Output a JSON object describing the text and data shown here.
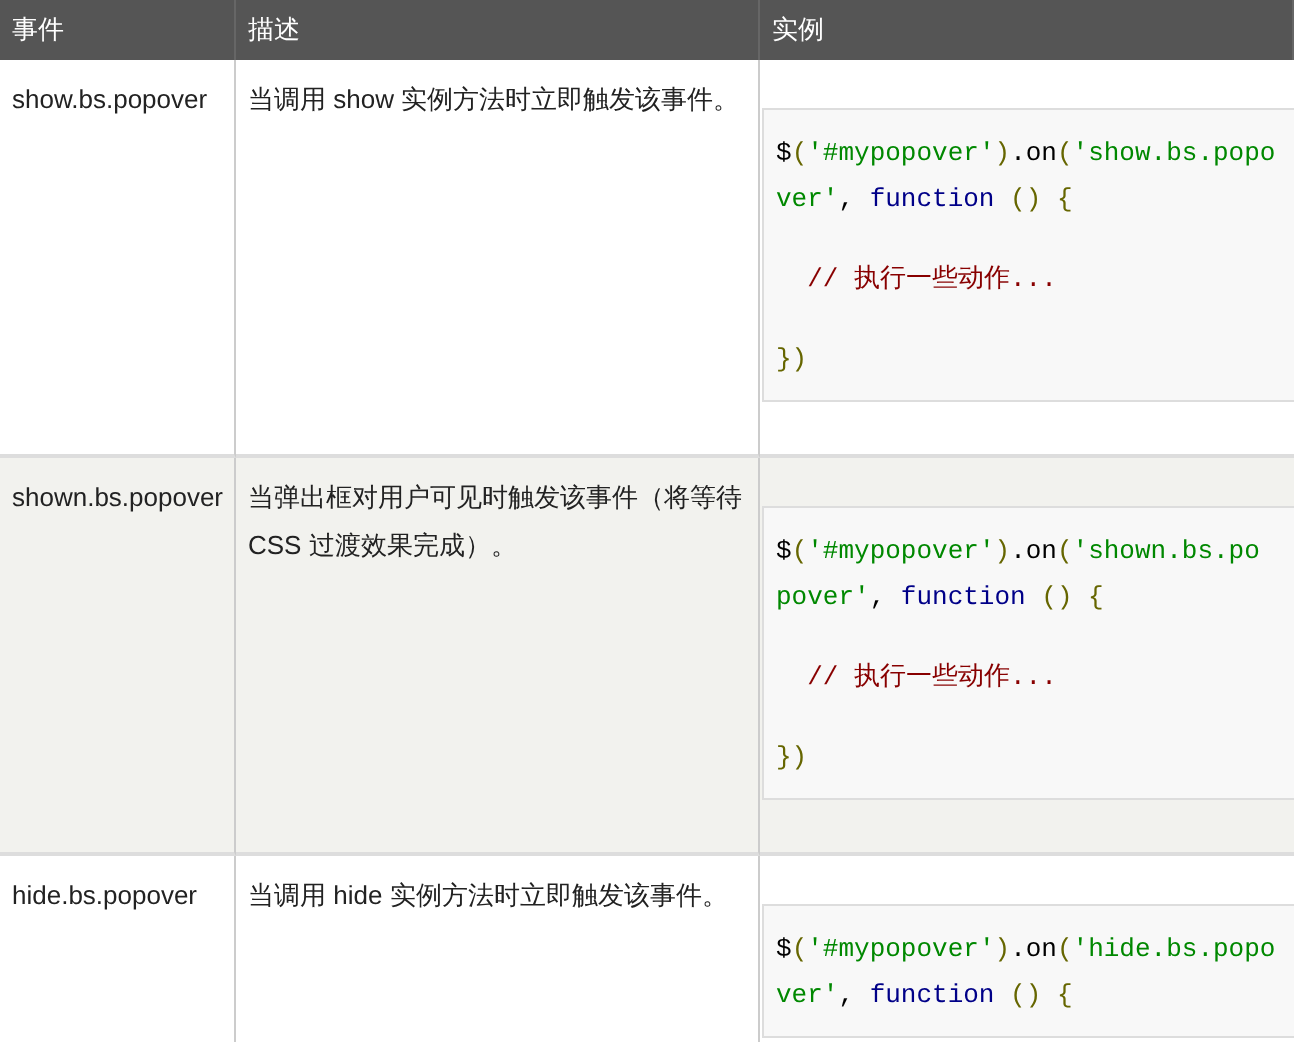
{
  "table": {
    "columns": [
      "事件",
      "描述",
      "实例"
    ],
    "rows": [
      {
        "event": "show.bs.popover",
        "description": "当调用 show 实例方法时立即触发该事件。",
        "code_blocks": [
          [
            {
              "tokens": [
                {
                  "text": "$",
                  "kind": "plain"
                },
                {
                  "text": "(",
                  "kind": "punct"
                },
                {
                  "text": "'#mypopover'",
                  "kind": "string"
                },
                {
                  "text": ")",
                  "kind": "punct"
                },
                {
                  "text": ".on",
                  "kind": "plain"
                },
                {
                  "text": "(",
                  "kind": "punct"
                },
                {
                  "text": "'show.bs.popo",
                  "kind": "string"
                }
              ]
            },
            {
              "tokens": [
                {
                  "text": "ver'",
                  "kind": "string"
                },
                {
                  "text": ", ",
                  "kind": "plain"
                },
                {
                  "text": "function",
                  "kind": "keyword"
                },
                {
                  "text": " () {",
                  "kind": "punct"
                }
              ]
            }
          ],
          [
            {
              "tokens": [
                {
                  "text": "  // 执行一些动作...",
                  "kind": "comment"
                }
              ]
            }
          ],
          [
            {
              "tokens": [
                {
                  "text": "})",
                  "kind": "punct"
                }
              ]
            }
          ]
        ]
      },
      {
        "event": "shown.bs.popover",
        "description": "当弹出框对用户可见时触发该事件（将等待 CSS 过渡效果完成）。",
        "code_blocks": [
          [
            {
              "tokens": [
                {
                  "text": "$",
                  "kind": "plain"
                },
                {
                  "text": "(",
                  "kind": "punct"
                },
                {
                  "text": "'#mypopover'",
                  "kind": "string"
                },
                {
                  "text": ")",
                  "kind": "punct"
                },
                {
                  "text": ".on",
                  "kind": "plain"
                },
                {
                  "text": "(",
                  "kind": "punct"
                },
                {
                  "text": "'shown.bs.po",
                  "kind": "string"
                }
              ]
            },
            {
              "tokens": [
                {
                  "text": "pover'",
                  "kind": "string"
                },
                {
                  "text": ", ",
                  "kind": "plain"
                },
                {
                  "text": "function",
                  "kind": "keyword"
                },
                {
                  "text": " () {",
                  "kind": "punct"
                }
              ]
            }
          ],
          [
            {
              "tokens": [
                {
                  "text": "  // 执行一些动作...",
                  "kind": "comment"
                }
              ]
            }
          ],
          [
            {
              "tokens": [
                {
                  "text": "})",
                  "kind": "punct"
                }
              ]
            }
          ]
        ]
      },
      {
        "event": "hide.bs.popover",
        "description": "当调用 hide 实例方法时立即触发该事件。",
        "code_blocks": [
          [
            {
              "tokens": [
                {
                  "text": "$",
                  "kind": "plain"
                },
                {
                  "text": "(",
                  "kind": "punct"
                },
                {
                  "text": "'#mypopover'",
                  "kind": "string"
                },
                {
                  "text": ")",
                  "kind": "punct"
                },
                {
                  "text": ".on",
                  "kind": "plain"
                },
                {
                  "text": "(",
                  "kind": "punct"
                },
                {
                  "text": "'hide.bs.popo",
                  "kind": "string"
                }
              ]
            },
            {
              "tokens": [
                {
                  "text": "ver'",
                  "kind": "string"
                },
                {
                  "text": ", ",
                  "kind": "plain"
                },
                {
                  "text": "function",
                  "kind": "keyword"
                },
                {
                  "text": " () {",
                  "kind": "punct"
                }
              ]
            }
          ]
        ]
      }
    ]
  }
}
